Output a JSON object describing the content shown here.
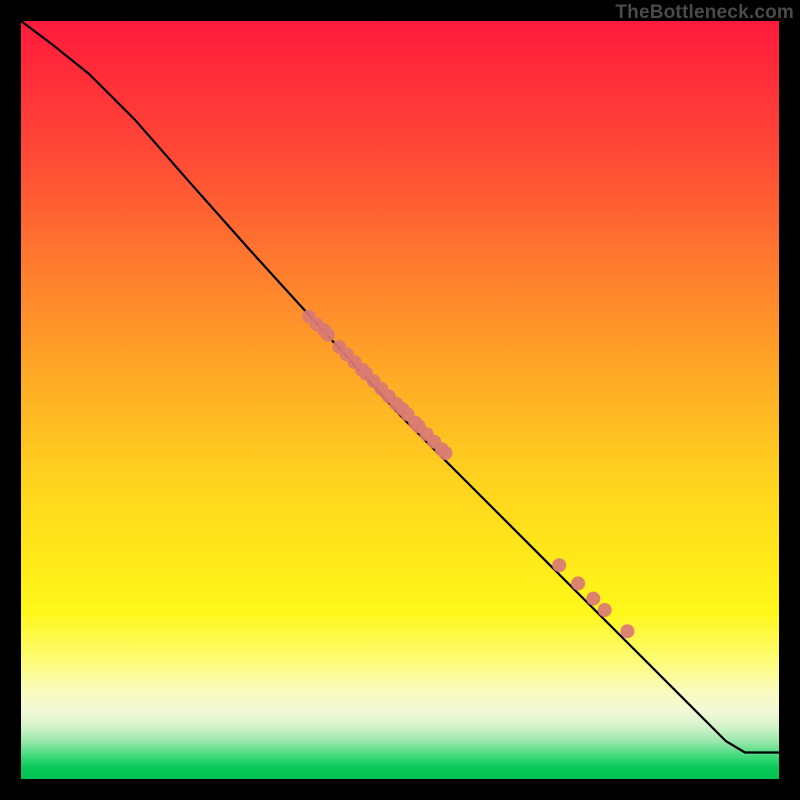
{
  "watermark": "TheBottleneck.com",
  "chart_data": {
    "type": "line",
    "title": "",
    "xlabel": "",
    "ylabel": "",
    "xlim": [
      0,
      1
    ],
    "ylim": [
      0,
      1
    ],
    "grid": false,
    "legend": false,
    "series": [
      {
        "name": "curve",
        "kind": "line",
        "x": [
          0.0,
          0.04,
          0.09,
          0.15,
          0.22,
          0.3,
          0.4,
          0.5,
          0.6,
          0.7,
          0.8,
          0.88,
          0.93,
          0.955,
          1.0
        ],
        "y": [
          1.0,
          0.97,
          0.93,
          0.87,
          0.79,
          0.7,
          0.59,
          0.48,
          0.38,
          0.28,
          0.18,
          0.1,
          0.05,
          0.035,
          0.035
        ]
      },
      {
        "name": "upper-cluster",
        "kind": "scatter",
        "x": [
          0.38,
          0.39,
          0.4,
          0.405,
          0.42,
          0.43,
          0.44,
          0.45,
          0.455,
          0.465,
          0.475,
          0.485,
          0.495,
          0.503,
          0.51,
          0.52,
          0.525,
          0.535,
          0.545,
          0.555,
          0.56
        ],
        "y": [
          0.61,
          0.6,
          0.592,
          0.586,
          0.57,
          0.56,
          0.55,
          0.54,
          0.535,
          0.525,
          0.515,
          0.505,
          0.495,
          0.488,
          0.481,
          0.47,
          0.465,
          0.455,
          0.445,
          0.435,
          0.43
        ]
      },
      {
        "name": "lower-cluster",
        "kind": "scatter",
        "x": [
          0.71,
          0.735,
          0.755,
          0.77,
          0.8
        ],
        "y": [
          0.282,
          0.258,
          0.238,
          0.223,
          0.195
        ]
      }
    ],
    "background_gradient": {
      "direction": "vertical",
      "stops": [
        {
          "pos": 0.0,
          "color": "#ff1a3d"
        },
        {
          "pos": 0.45,
          "color": "#ffa726"
        },
        {
          "pos": 0.72,
          "color": "#ffe71a"
        },
        {
          "pos": 0.9,
          "color": "#f2f9d6"
        },
        {
          "pos": 1.0,
          "color": "#04c254"
        }
      ]
    },
    "colors": {
      "line": "#000000",
      "dots": "#d97a74",
      "frame": "#000000"
    }
  }
}
